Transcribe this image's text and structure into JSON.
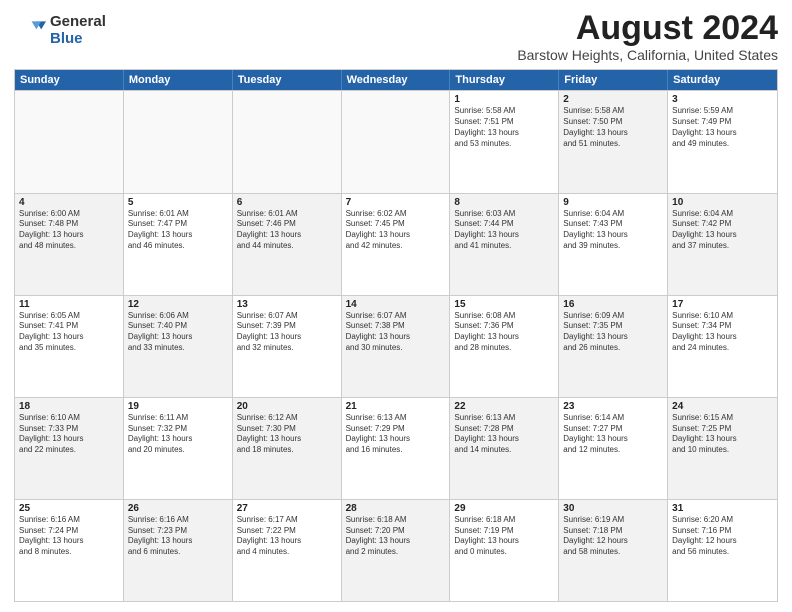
{
  "logo": {
    "general": "General",
    "blue": "Blue"
  },
  "title": "August 2024",
  "subtitle": "Barstow Heights, California, United States",
  "header_days": [
    "Sunday",
    "Monday",
    "Tuesday",
    "Wednesday",
    "Thursday",
    "Friday",
    "Saturday"
  ],
  "weeks": [
    [
      {
        "day": "",
        "lines": [],
        "empty": true
      },
      {
        "day": "",
        "lines": [],
        "empty": true
      },
      {
        "day": "",
        "lines": [],
        "empty": true
      },
      {
        "day": "",
        "lines": [],
        "empty": true
      },
      {
        "day": "1",
        "lines": [
          "Sunrise: 5:58 AM",
          "Sunset: 7:51 PM",
          "Daylight: 13 hours",
          "and 53 minutes."
        ]
      },
      {
        "day": "2",
        "lines": [
          "Sunrise: 5:58 AM",
          "Sunset: 7:50 PM",
          "Daylight: 13 hours",
          "and 51 minutes."
        ],
        "shaded": true
      },
      {
        "day": "3",
        "lines": [
          "Sunrise: 5:59 AM",
          "Sunset: 7:49 PM",
          "Daylight: 13 hours",
          "and 49 minutes."
        ]
      }
    ],
    [
      {
        "day": "4",
        "lines": [
          "Sunrise: 6:00 AM",
          "Sunset: 7:48 PM",
          "Daylight: 13 hours",
          "and 48 minutes."
        ],
        "shaded": true
      },
      {
        "day": "5",
        "lines": [
          "Sunrise: 6:01 AM",
          "Sunset: 7:47 PM",
          "Daylight: 13 hours",
          "and 46 minutes."
        ]
      },
      {
        "day": "6",
        "lines": [
          "Sunrise: 6:01 AM",
          "Sunset: 7:46 PM",
          "Daylight: 13 hours",
          "and 44 minutes."
        ],
        "shaded": true
      },
      {
        "day": "7",
        "lines": [
          "Sunrise: 6:02 AM",
          "Sunset: 7:45 PM",
          "Daylight: 13 hours",
          "and 42 minutes."
        ]
      },
      {
        "day": "8",
        "lines": [
          "Sunrise: 6:03 AM",
          "Sunset: 7:44 PM",
          "Daylight: 13 hours",
          "and 41 minutes."
        ],
        "shaded": true
      },
      {
        "day": "9",
        "lines": [
          "Sunrise: 6:04 AM",
          "Sunset: 7:43 PM",
          "Daylight: 13 hours",
          "and 39 minutes."
        ]
      },
      {
        "day": "10",
        "lines": [
          "Sunrise: 6:04 AM",
          "Sunset: 7:42 PM",
          "Daylight: 13 hours",
          "and 37 minutes."
        ],
        "shaded": true
      }
    ],
    [
      {
        "day": "11",
        "lines": [
          "Sunrise: 6:05 AM",
          "Sunset: 7:41 PM",
          "Daylight: 13 hours",
          "and 35 minutes."
        ]
      },
      {
        "day": "12",
        "lines": [
          "Sunrise: 6:06 AM",
          "Sunset: 7:40 PM",
          "Daylight: 13 hours",
          "and 33 minutes."
        ],
        "shaded": true
      },
      {
        "day": "13",
        "lines": [
          "Sunrise: 6:07 AM",
          "Sunset: 7:39 PM",
          "Daylight: 13 hours",
          "and 32 minutes."
        ]
      },
      {
        "day": "14",
        "lines": [
          "Sunrise: 6:07 AM",
          "Sunset: 7:38 PM",
          "Daylight: 13 hours",
          "and 30 minutes."
        ],
        "shaded": true
      },
      {
        "day": "15",
        "lines": [
          "Sunrise: 6:08 AM",
          "Sunset: 7:36 PM",
          "Daylight: 13 hours",
          "and 28 minutes."
        ]
      },
      {
        "day": "16",
        "lines": [
          "Sunrise: 6:09 AM",
          "Sunset: 7:35 PM",
          "Daylight: 13 hours",
          "and 26 minutes."
        ],
        "shaded": true
      },
      {
        "day": "17",
        "lines": [
          "Sunrise: 6:10 AM",
          "Sunset: 7:34 PM",
          "Daylight: 13 hours",
          "and 24 minutes."
        ]
      }
    ],
    [
      {
        "day": "18",
        "lines": [
          "Sunrise: 6:10 AM",
          "Sunset: 7:33 PM",
          "Daylight: 13 hours",
          "and 22 minutes."
        ],
        "shaded": true
      },
      {
        "day": "19",
        "lines": [
          "Sunrise: 6:11 AM",
          "Sunset: 7:32 PM",
          "Daylight: 13 hours",
          "and 20 minutes."
        ]
      },
      {
        "day": "20",
        "lines": [
          "Sunrise: 6:12 AM",
          "Sunset: 7:30 PM",
          "Daylight: 13 hours",
          "and 18 minutes."
        ],
        "shaded": true
      },
      {
        "day": "21",
        "lines": [
          "Sunrise: 6:13 AM",
          "Sunset: 7:29 PM",
          "Daylight: 13 hours",
          "and 16 minutes."
        ]
      },
      {
        "day": "22",
        "lines": [
          "Sunrise: 6:13 AM",
          "Sunset: 7:28 PM",
          "Daylight: 13 hours",
          "and 14 minutes."
        ],
        "shaded": true
      },
      {
        "day": "23",
        "lines": [
          "Sunrise: 6:14 AM",
          "Sunset: 7:27 PM",
          "Daylight: 13 hours",
          "and 12 minutes."
        ]
      },
      {
        "day": "24",
        "lines": [
          "Sunrise: 6:15 AM",
          "Sunset: 7:25 PM",
          "Daylight: 13 hours",
          "and 10 minutes."
        ],
        "shaded": true
      }
    ],
    [
      {
        "day": "25",
        "lines": [
          "Sunrise: 6:16 AM",
          "Sunset: 7:24 PM",
          "Daylight: 13 hours",
          "and 8 minutes."
        ]
      },
      {
        "day": "26",
        "lines": [
          "Sunrise: 6:16 AM",
          "Sunset: 7:23 PM",
          "Daylight: 13 hours",
          "and 6 minutes."
        ],
        "shaded": true
      },
      {
        "day": "27",
        "lines": [
          "Sunrise: 6:17 AM",
          "Sunset: 7:22 PM",
          "Daylight: 13 hours",
          "and 4 minutes."
        ]
      },
      {
        "day": "28",
        "lines": [
          "Sunrise: 6:18 AM",
          "Sunset: 7:20 PM",
          "Daylight: 13 hours",
          "and 2 minutes."
        ],
        "shaded": true
      },
      {
        "day": "29",
        "lines": [
          "Sunrise: 6:18 AM",
          "Sunset: 7:19 PM",
          "Daylight: 13 hours",
          "and 0 minutes."
        ]
      },
      {
        "day": "30",
        "lines": [
          "Sunrise: 6:19 AM",
          "Sunset: 7:18 PM",
          "Daylight: 12 hours",
          "and 58 minutes."
        ],
        "shaded": true
      },
      {
        "day": "31",
        "lines": [
          "Sunrise: 6:20 AM",
          "Sunset: 7:16 PM",
          "Daylight: 12 hours",
          "and 56 minutes."
        ]
      }
    ]
  ]
}
